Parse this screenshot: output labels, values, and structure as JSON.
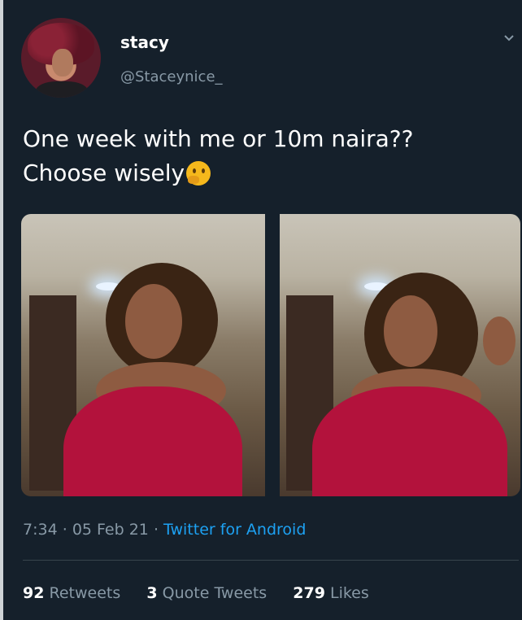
{
  "tweet": {
    "display_name": "stacy",
    "handle": "@Staceynice_",
    "text_line1": "One week with me or 10m naira??",
    "text_line2": "Choose wisely",
    "emoji": "thinking-face",
    "time": "7:34",
    "date": "05 Feb 21",
    "separator": "·",
    "source": "Twitter for Android",
    "retweets_count": "92",
    "retweets_label": "Retweets",
    "quotes_count": "3",
    "quotes_label": "Quote Tweets",
    "likes_count": "279",
    "likes_label": "Likes"
  },
  "icons": {
    "menu": "chevron-down-icon"
  },
  "colors": {
    "background": "#15202b",
    "link": "#1da1f2",
    "muted": "#8899a6",
    "top_color": "#b3123c"
  }
}
